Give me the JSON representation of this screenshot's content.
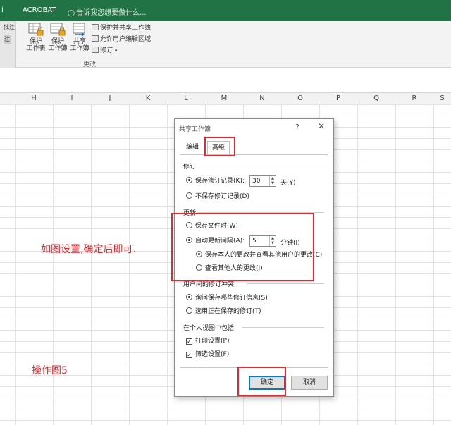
{
  "ribbon": {
    "tab_left": "i",
    "tab_acrobat": "ACROBAT",
    "tell_me": "告诉我您想要做什么...",
    "left_cut_top": "批注",
    "left_cut_bottom": "注",
    "btn_protect_sheet": [
      "保护",
      "工作表"
    ],
    "btn_protect_book": [
      "保护",
      "工作簿"
    ],
    "btn_share_book": [
      "共享",
      "工作簿"
    ],
    "cmd_protect_share": "保护并共享工作簿",
    "cmd_allow_edit": "允许用户编辑区域",
    "cmd_track": "修订",
    "group_label": "更改"
  },
  "columns": [
    "H",
    "I",
    "J",
    "K",
    "L",
    "M",
    "N",
    "O",
    "P",
    "Q",
    "R",
    "S"
  ],
  "notes": {
    "instruction": "如图设置,确定后即可.",
    "figure": "操作图5"
  },
  "dialog": {
    "title": "共享工作簿",
    "help": "?",
    "close": "✕",
    "tabs": {
      "edit": "编辑",
      "advanced": "高级"
    },
    "track": {
      "heading": "修订",
      "keep_history": "保存修订记录(K):",
      "keep_days": "30",
      "days_unit": "天(Y)",
      "no_history": "不保存修订记录(D)"
    },
    "update": {
      "heading": "更新",
      "on_save": "保存文件时(W)",
      "auto_every": "自动更新间隔(A):",
      "minutes": "5",
      "minutes_unit": "分钟(I)",
      "save_and_see": "保存本人的更改并查看其他用户的更改(C)",
      "just_see": "查看其他人的更改(J)"
    },
    "conflict": {
      "heading": "用户间的修订冲突",
      "ask": "询问保存哪些修订信息(S)",
      "win": "选用正在保存的修订(T)"
    },
    "personal": {
      "heading": "在个人视图中包括",
      "print": "打印设置(P)",
      "filter": "筛选设置(F)"
    },
    "ok": "确定",
    "cancel": "取消"
  }
}
